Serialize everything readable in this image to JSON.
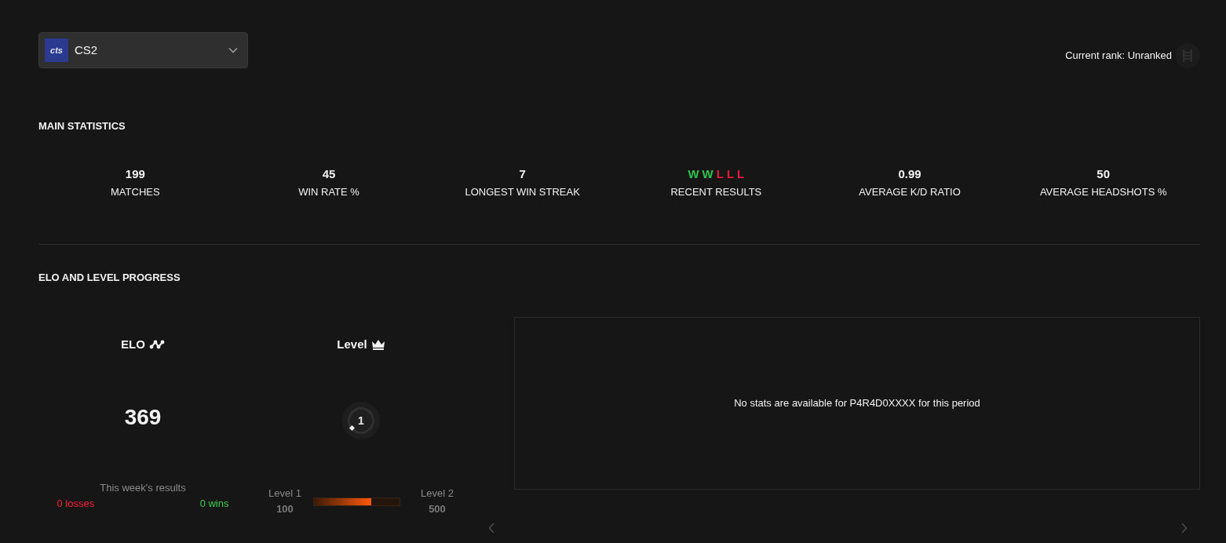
{
  "game_selector": {
    "logo_text": "cts",
    "value": "CS2"
  },
  "current_rank": {
    "label": "Current rank: Unranked"
  },
  "main_statistics": {
    "title": "MAIN STATISTICS",
    "stats": [
      {
        "kind": "number",
        "value": "199",
        "label": "MATCHES"
      },
      {
        "kind": "number",
        "value": "45",
        "label": "WIN RATE %"
      },
      {
        "kind": "number",
        "value": "7",
        "label": "LONGEST WIN STREAK"
      },
      {
        "kind": "results",
        "results": [
          {
            "result": "W",
            "color": "#2ec44f"
          },
          {
            "result": "W",
            "color": "#2ec44f"
          },
          {
            "result": "L",
            "color": "#e5173b"
          },
          {
            "result": "L",
            "color": "#e5173b"
          },
          {
            "result": "L",
            "color": "#e5173b"
          }
        ],
        "label": "RECENT RESULTS"
      },
      {
        "kind": "number",
        "value": "0.99",
        "label": "AVERAGE K/D RATIO"
      },
      {
        "kind": "number",
        "value": "50",
        "label": "AVERAGE HEADSHOTS %"
      }
    ]
  },
  "elo_and_level_progress": {
    "title": "ELO AND LEVEL PROGRESS",
    "elo": {
      "title": "ELO",
      "value": "369",
      "weekly_results": {
        "title": "This week's results",
        "losses": "0 losses",
        "wins": "0 wins"
      }
    },
    "level": {
      "title": "Level",
      "badge": "1",
      "progress": {
        "from_label": "Level 1",
        "from_value": "100",
        "to_label": "Level 2",
        "to_value": "500",
        "level": 0.67
      }
    },
    "chart_panel": {
      "message": "No stats are available for P4R4D0XXXX for this period"
    }
  }
}
